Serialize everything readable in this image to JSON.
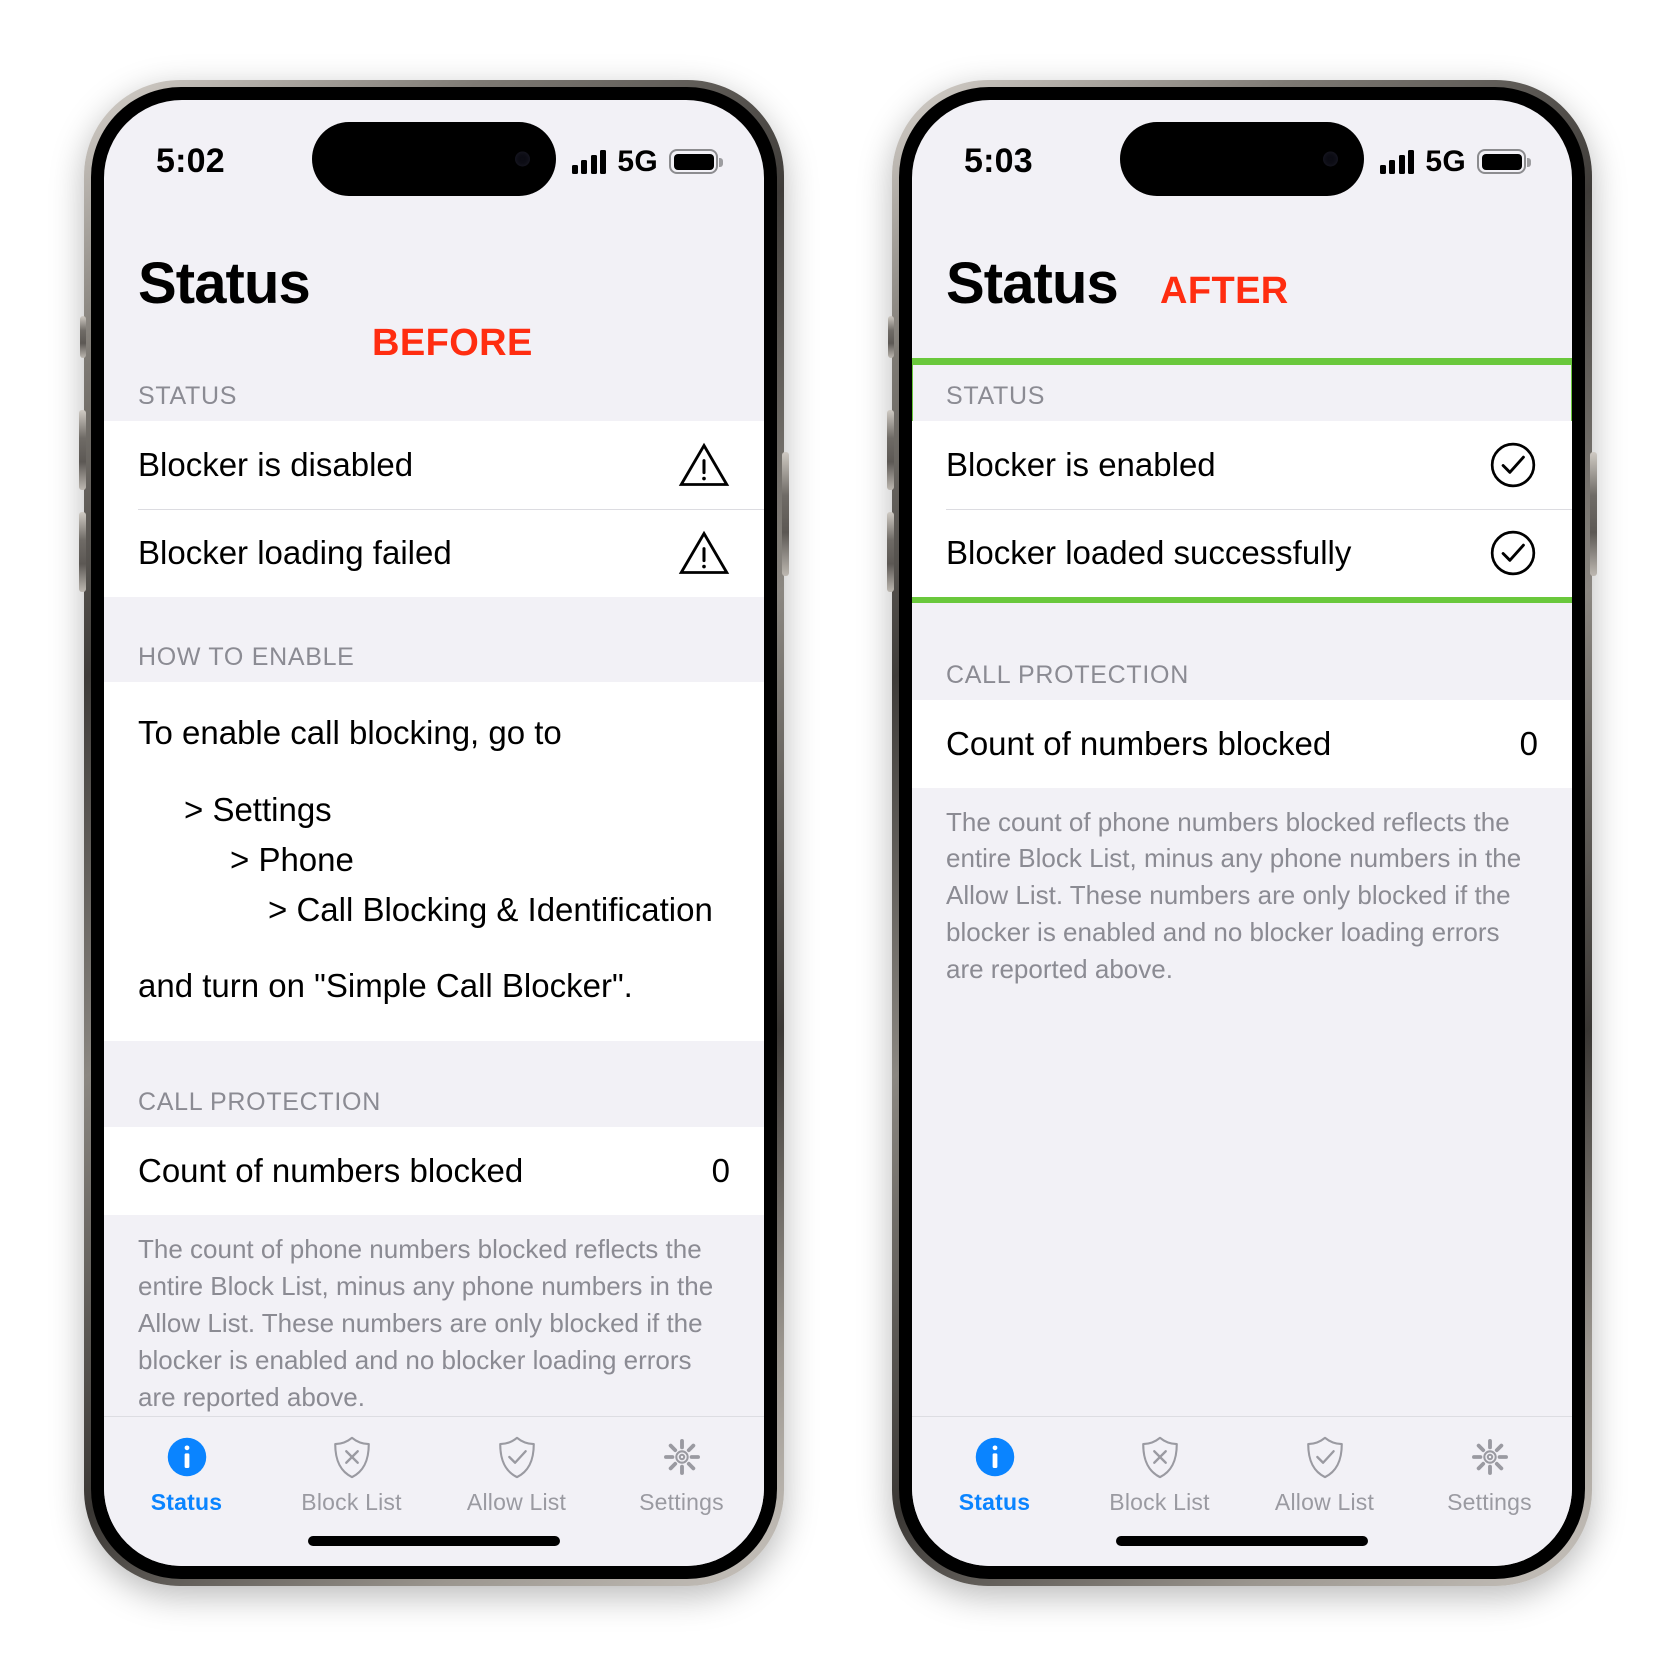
{
  "phones": [
    {
      "id": "before",
      "annotation": "BEFORE",
      "annotation_color": "#ff2d10",
      "statusbar": {
        "time": "5:02",
        "network": "5G",
        "signal_bars": 4,
        "battery_full": true
      },
      "title": "Status",
      "sections": [
        {
          "key": "status",
          "header": "STATUS",
          "highlighted": false,
          "rows": [
            {
              "label": "Blocker is disabled",
              "icon": "warning-triangle-icon"
            },
            {
              "label": "Blocker loading failed",
              "icon": "warning-triangle-icon"
            }
          ]
        },
        {
          "key": "howto",
          "header": "HOW TO ENABLE",
          "highlighted": false,
          "body": {
            "intro": "To enable call blocking, go to",
            "steps": [
              "> Settings",
              "> Phone",
              "> Call Blocking & Identification"
            ],
            "outro": "and turn on \"Simple Call Blocker\"."
          }
        },
        {
          "key": "callprotection",
          "header": "CALL PROTECTION",
          "highlighted": false,
          "rows": [
            {
              "label": "Count of numbers blocked",
              "value": "0"
            }
          ],
          "footnote": "The count of phone numbers blocked reflects the entire Block List, minus any phone numbers in the Allow List. These numbers are only blocked if the blocker is enabled and no blocker loading errors are reported above."
        }
      ],
      "tabs": [
        {
          "label": "Status",
          "icon": "info-circle-icon",
          "active": true
        },
        {
          "label": "Block List",
          "icon": "shield-x-icon",
          "active": false
        },
        {
          "label": "Allow List",
          "icon": "shield-check-icon",
          "active": false
        },
        {
          "label": "Settings",
          "icon": "gear-icon",
          "active": false
        }
      ]
    },
    {
      "id": "after",
      "annotation": "AFTER",
      "annotation_color": "#ff2d10",
      "statusbar": {
        "time": "5:03",
        "network": "5G",
        "signal_bars": 4,
        "battery_full": true
      },
      "title": "Status",
      "sections": [
        {
          "key": "status",
          "header": "STATUS",
          "highlighted": true,
          "highlight_color": "#6ac83c",
          "rows": [
            {
              "label": "Blocker is enabled",
              "icon": "check-circle-icon"
            },
            {
              "label": "Blocker loaded successfully",
              "icon": "check-circle-icon"
            }
          ]
        },
        {
          "key": "callprotection",
          "header": "CALL PROTECTION",
          "highlighted": false,
          "rows": [
            {
              "label": "Count of numbers blocked",
              "value": "0"
            }
          ],
          "footnote": "The count of phone numbers blocked reflects the entire Block List, minus any phone numbers in the Allow List. These numbers are only blocked if the blocker is enabled and no blocker loading errors are reported above."
        }
      ],
      "tabs": [
        {
          "label": "Status",
          "icon": "info-circle-icon",
          "active": true
        },
        {
          "label": "Block List",
          "icon": "shield-x-icon",
          "active": false
        },
        {
          "label": "Allow List",
          "icon": "shield-check-icon",
          "active": false
        },
        {
          "label": "Settings",
          "icon": "gear-icon",
          "active": false
        }
      ]
    }
  ]
}
